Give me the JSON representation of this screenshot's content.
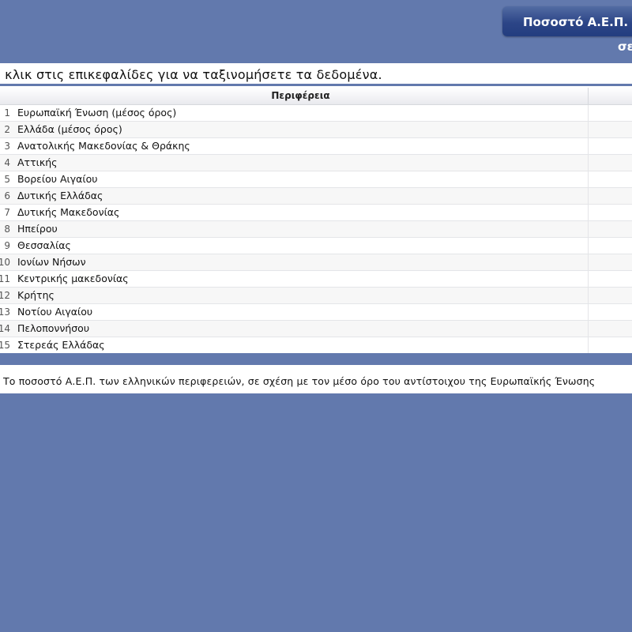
{
  "header": {
    "title": "Ποσοστό Α.Ε.Π.",
    "subtitle": "σε"
  },
  "instruction": "ε κλικ στις επικεφαλίδες για να ταξινομήσετε τα δεδομένα.",
  "table": {
    "columns": [
      "Περιφέρεια"
    ],
    "rows": [
      {
        "num": "1",
        "region": "Ευρωπαϊκή Ένωση (μέσος όρος)"
      },
      {
        "num": "2",
        "region": "Ελλάδα (μέσος όρος)"
      },
      {
        "num": "3",
        "region": "Ανατολικής Μακεδονίας & Θράκης"
      },
      {
        "num": "4",
        "region": "Αττικής"
      },
      {
        "num": "5",
        "region": "Βορείου Αιγαίου"
      },
      {
        "num": "6",
        "region": "Δυτικής Ελλάδας"
      },
      {
        "num": "7",
        "region": "Δυτικής Μακεδονίας"
      },
      {
        "num": "8",
        "region": "Ηπείρου"
      },
      {
        "num": "9",
        "region": "Θεσσαλίας"
      },
      {
        "num": "10",
        "region": "Ιονίων Νήσων"
      },
      {
        "num": "11",
        "region": "Κεντρικής μακεδονίας"
      },
      {
        "num": "12",
        "region": "Κρήτης"
      },
      {
        "num": "13",
        "region": "Νοτίου Αιγαίου"
      },
      {
        "num": "14",
        "region": "Πελοποννήσου"
      },
      {
        "num": "15",
        "region": "Στερεάς Ελλάδας"
      }
    ]
  },
  "caption": "Το ποσοστό Α.Ε.Π. των ελληνικών περιφερειών, σε σχέση με τον μέσο όρο του αντίστοιχου της Ευρωπαϊκής Ένωσης",
  "colors": {
    "background": "#6279ad",
    "title_tab": "#2c4587",
    "header_text": "#ffffff"
  }
}
